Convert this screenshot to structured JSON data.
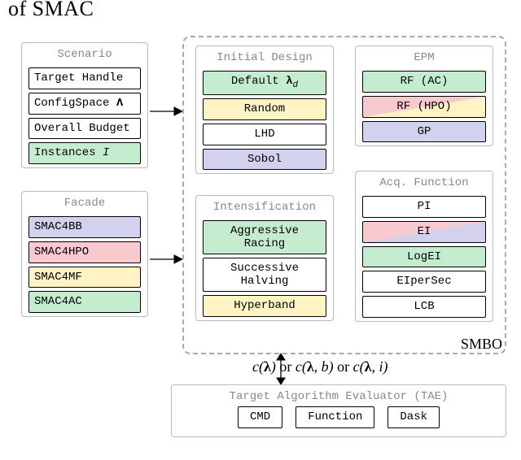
{
  "heading_fragment": "of SMAC",
  "scenario": {
    "title": "Scenario",
    "items": [
      {
        "label": "Target Handle",
        "color": "white"
      },
      {
        "label_html": "ConfigSpace <span class='math-b'>Λ</span>",
        "color": "white"
      },
      {
        "label": "Overall Budget",
        "color": "white"
      },
      {
        "label_html": "Instances <span class='math-i'>I</span>",
        "color": "green"
      }
    ]
  },
  "facade": {
    "title": "Facade",
    "items": [
      {
        "label": "SMAC4BB",
        "color": "purple"
      },
      {
        "label": "SMAC4HPO",
        "color": "red"
      },
      {
        "label": "SMAC4MF",
        "color": "yellow"
      },
      {
        "label": "SMAC4AC",
        "color": "green"
      }
    ]
  },
  "initial_design": {
    "title": "Initial Design",
    "items": [
      {
        "label_html": "Default <span class='math-b'>λ</span><span class='sub'>d</span>",
        "color": "green"
      },
      {
        "label": "Random",
        "color": "yellow"
      },
      {
        "label": "LHD",
        "color": "white"
      },
      {
        "label": "Sobol",
        "color": "purple"
      }
    ]
  },
  "intensification": {
    "title": "Intensification",
    "items": [
      {
        "label": "Aggressive Racing",
        "color": "green",
        "multiline": true
      },
      {
        "label": "Successive Halving",
        "color": "white",
        "multiline": true
      },
      {
        "label": "Hyperband",
        "color": "yellow"
      }
    ]
  },
  "epm": {
    "title": "EPM",
    "items": [
      {
        "label": "RF (AC)",
        "color": "green"
      },
      {
        "label": "RF (HPO)",
        "color": "diag-ry"
      },
      {
        "label": "GP",
        "color": "purple"
      }
    ]
  },
  "acq": {
    "title": "Acq.  Function",
    "items": [
      {
        "label": "PI",
        "color": "white"
      },
      {
        "label": "EI",
        "color": "diag-rp"
      },
      {
        "label": "LogEI",
        "color": "green"
      },
      {
        "label": "EIperSec",
        "color": "white"
      },
      {
        "label": "LCB",
        "color": "white"
      }
    ]
  },
  "smbo_label": "SMBO",
  "cost_label_html": "c(<span class='math-b'>λ</span>)&nbsp;<span class='plain'>or</span>&nbsp;c(<span class='math-b'>λ</span>, b)&nbsp;<span class='plain'>or</span>&nbsp;c(<span class='math-b'>λ</span>, i)",
  "tae": {
    "title": "Target Algorithm Evaluator (TAE)",
    "items": [
      {
        "label": "CMD",
        "color": "white"
      },
      {
        "label": "Function",
        "color": "white"
      },
      {
        "label": "Dask",
        "color": "white"
      }
    ]
  }
}
